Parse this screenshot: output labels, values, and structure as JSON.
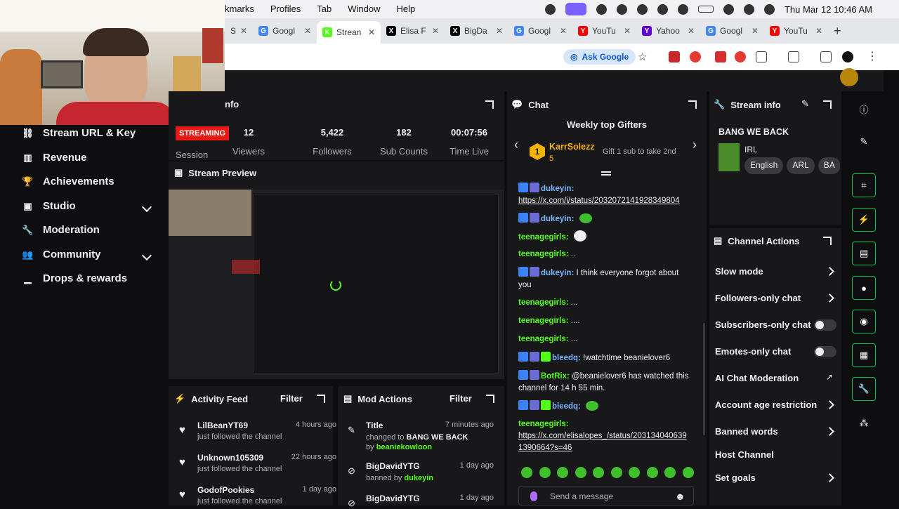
{
  "macos_menu": [
    "kmarks",
    "Profiles",
    "Tab",
    "Window",
    "Help"
  ],
  "clock": "Thu Mar 12  10:46 AM",
  "tabs": [
    {
      "title": "S",
      "favicon_color": "#ffffff",
      "icon": "blank"
    },
    {
      "title": "Googl",
      "favicon_color": "#4285f4",
      "icon": "G"
    },
    {
      "title": "Strean",
      "favicon_color": "#53fc18",
      "icon": "K"
    },
    {
      "title": "Elisa F",
      "favicon_color": "#000000",
      "icon": "X"
    },
    {
      "title": "BigDa",
      "favicon_color": "#000000",
      "icon": "X"
    },
    {
      "title": "Googl",
      "favicon_color": "#4285f4",
      "icon": "G"
    },
    {
      "title": "YouTu",
      "favicon_color": "#ff0000",
      "icon": "Y"
    },
    {
      "title": "Yahoo",
      "favicon_color": "#6001d2",
      "icon": "Y"
    },
    {
      "title": "Googl",
      "favicon_color": "#4285f4",
      "icon": "G"
    },
    {
      "title": "YouTu",
      "favicon_color": "#ff0000",
      "icon": "Y"
    }
  ],
  "ask_google": "Ask Google",
  "nav": {
    "items": [
      {
        "label": "Stream URL & Key",
        "icon": "link-icon"
      },
      {
        "label": "Revenue",
        "icon": "revenue-icon"
      },
      {
        "label": "Achievements",
        "icon": "trophy-icon"
      },
      {
        "label": "Studio",
        "icon": "studio-icon",
        "expandable": true
      },
      {
        "label": "Moderation",
        "icon": "wrench-icon"
      },
      {
        "label": "Community",
        "icon": "community-icon",
        "expandable": true
      },
      {
        "label": "Drops & rewards",
        "icon": "drops-icon"
      }
    ]
  },
  "session": {
    "header": "nfo",
    "status": "STREAMING",
    "session_label": "Session",
    "stats": [
      {
        "value": "12",
        "label": "Viewers"
      },
      {
        "value": "5,422",
        "label": "Followers"
      },
      {
        "value": "182",
        "label": "Sub Counts"
      },
      {
        "value": "00:07:56",
        "label": "Time Live"
      }
    ]
  },
  "preview": {
    "title": "Stream Preview"
  },
  "activity": {
    "title": "Activity Feed",
    "filter": "Filter",
    "items": [
      {
        "name": "LilBeanYT69",
        "time": "4 hours ago",
        "desc": "just followed the channel"
      },
      {
        "name": "Unknown105309",
        "time": "22 hours ago",
        "desc": "just followed the channel"
      },
      {
        "name": "GodofPookies",
        "time": "1 day ago",
        "desc": "just followed the channel"
      }
    ]
  },
  "mod": {
    "title": "Mod Actions",
    "filter": "Filter",
    "items": [
      {
        "name": "Title",
        "time": "7 minutes ago",
        "desc_a": "changed to ",
        "desc_b": "BANG WE BACK",
        "desc_c": " by ",
        "desc_d": "beaniekowloon"
      },
      {
        "name": "BigDavidYTG",
        "time": "1 day ago",
        "desc_a": "banned by ",
        "desc_d": "dukeyin"
      },
      {
        "name": "BigDavidYTG",
        "time": "1 day ago"
      }
    ]
  },
  "chat": {
    "title": "Chat",
    "gifters_title": "Weekly top Gifters",
    "top_gifter": "KarrSolezz",
    "gifter_rank": "1",
    "gifter_count": "5",
    "gift_hint": "Gift 1 sub to take 2nd",
    "messages": [
      {
        "user": "dukeyin:",
        "color": "#7ab4ff",
        "text": "",
        "link": "https://x.com/i/status/2032072141928349804"
      },
      {
        "user": "dukeyin:",
        "color": "#7ab4ff",
        "text": ""
      },
      {
        "user": "teenagegirls:",
        "color": "#53fc18",
        "text": ""
      },
      {
        "user": "teenagegirls:",
        "color": "#53fc18",
        "text": ".."
      },
      {
        "user": "dukeyin:",
        "color": "#7ab4ff",
        "text": "I think everyone forgot about you"
      },
      {
        "user": "teenagegirls:",
        "color": "#53fc18",
        "text": "..."
      },
      {
        "user": "teenagegirls:",
        "color": "#53fc18",
        "text": "...."
      },
      {
        "user": "teenagegirls:",
        "color": "#53fc18",
        "text": "..."
      },
      {
        "user": "bleedq:",
        "color": "#7ab4ff",
        "text": "!watchtime beanielover6"
      },
      {
        "user": "BotRix:",
        "color": "#53fc18",
        "text": "@beanielover6 has watched this channel for 14 h 55 min."
      },
      {
        "user": "bleedq:",
        "color": "#7ab4ff",
        "text": ""
      },
      {
        "user": "teenagegirls:",
        "color": "#53fc18",
        "text": "",
        "link": "https://x.com/elisalopes_/status/2031340406391390664?s=46"
      }
    ],
    "input_placeholder": "Send a message"
  },
  "stream_info": {
    "title": "Stream info",
    "stream_title": "BANG WE BACK",
    "category": "IRL",
    "tags": [
      "English",
      "ARL",
      "BA"
    ]
  },
  "channel_actions": {
    "title": "Channel Actions",
    "items": [
      {
        "label": "Slow mode",
        "control": "arrow"
      },
      {
        "label": "Followers-only chat",
        "control": "arrow"
      },
      {
        "label": "Subscribers-only chat",
        "control": "toggle-off"
      },
      {
        "label": "Emotes-only chat",
        "control": "toggle-off"
      },
      {
        "label": "AI Chat Moderation",
        "control": "external"
      },
      {
        "label": "Account age restriction",
        "control": "arrow"
      },
      {
        "label": "Banned words",
        "control": "arrow"
      },
      {
        "label": "Host Channel",
        "control": "none"
      },
      {
        "label": "Set goals",
        "control": "arrow"
      }
    ]
  },
  "accent": "#53fc18"
}
